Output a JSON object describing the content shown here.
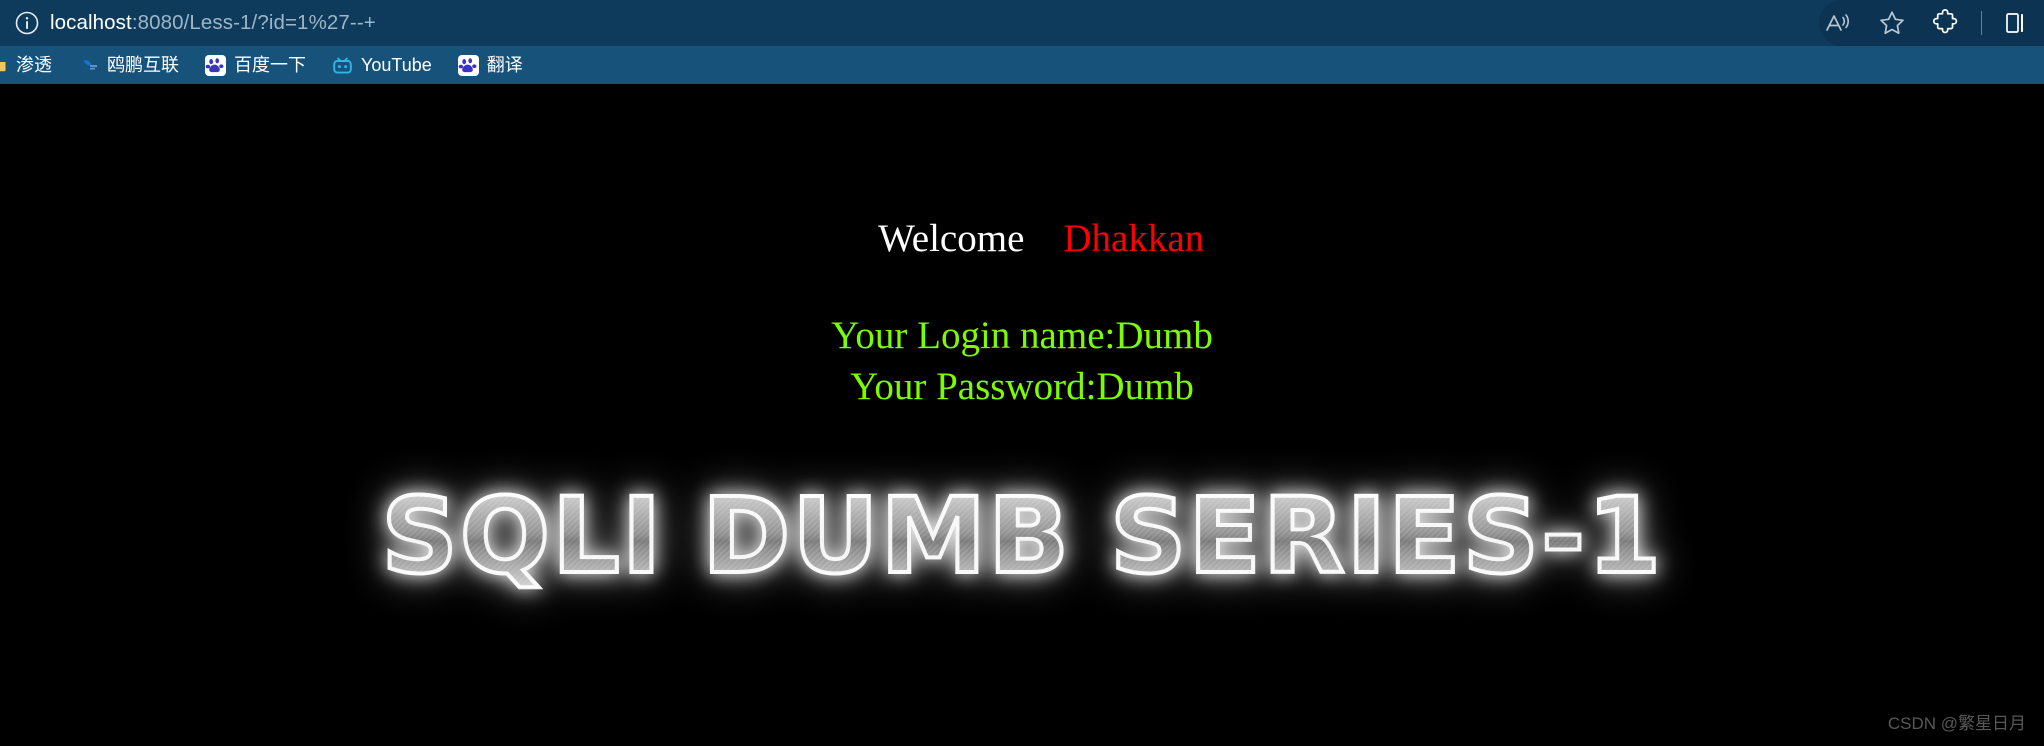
{
  "browser": {
    "address_bar": {
      "site_info_icon": "info-circle-icon",
      "url_host": "localhost",
      "url_rest": ":8080/Less-1/?id=1%27--+",
      "url_full": "localhost:8080/Less-1/?id=1%27--+"
    },
    "toolbar_icons": [
      {
        "name": "read-aloud-icon",
        "label": "A))"
      },
      {
        "name": "favorites-star-icon",
        "label": "Favorites"
      },
      {
        "name": "extensions-puzzle-icon",
        "label": "Extensions"
      },
      {
        "name": "collections-icon",
        "label": "Collections"
      }
    ],
    "bookmarks": [
      {
        "label": "渗透",
        "icon": "folder-icon"
      },
      {
        "label": "鸥鹏互联",
        "icon": "oupeng-icon"
      },
      {
        "label": "百度一下",
        "icon": "baidu-icon"
      },
      {
        "label": "YouTube",
        "icon": "video-tv-icon"
      },
      {
        "label": "翻译",
        "icon": "baidu-icon"
      }
    ]
  },
  "page": {
    "welcome_label": "Welcome",
    "welcome_user": "Dhakkan",
    "login_line": "Your Login name:Dumb",
    "password_line": "Your Password:Dumb",
    "logo_text": "SQLI DUMB SERIES-1",
    "watermark": "CSDN @繁星日月"
  },
  "colors": {
    "chrome_bg": "#0e3a5c",
    "bookmarks_bg": "#17527a",
    "page_bg": "#000000",
    "welcome_color": "#ffffff",
    "user_color": "#ff0000",
    "cred_color": "#7cfc00",
    "url_host_color": "#ffffff",
    "url_rest_color": "#9fb6c6"
  }
}
